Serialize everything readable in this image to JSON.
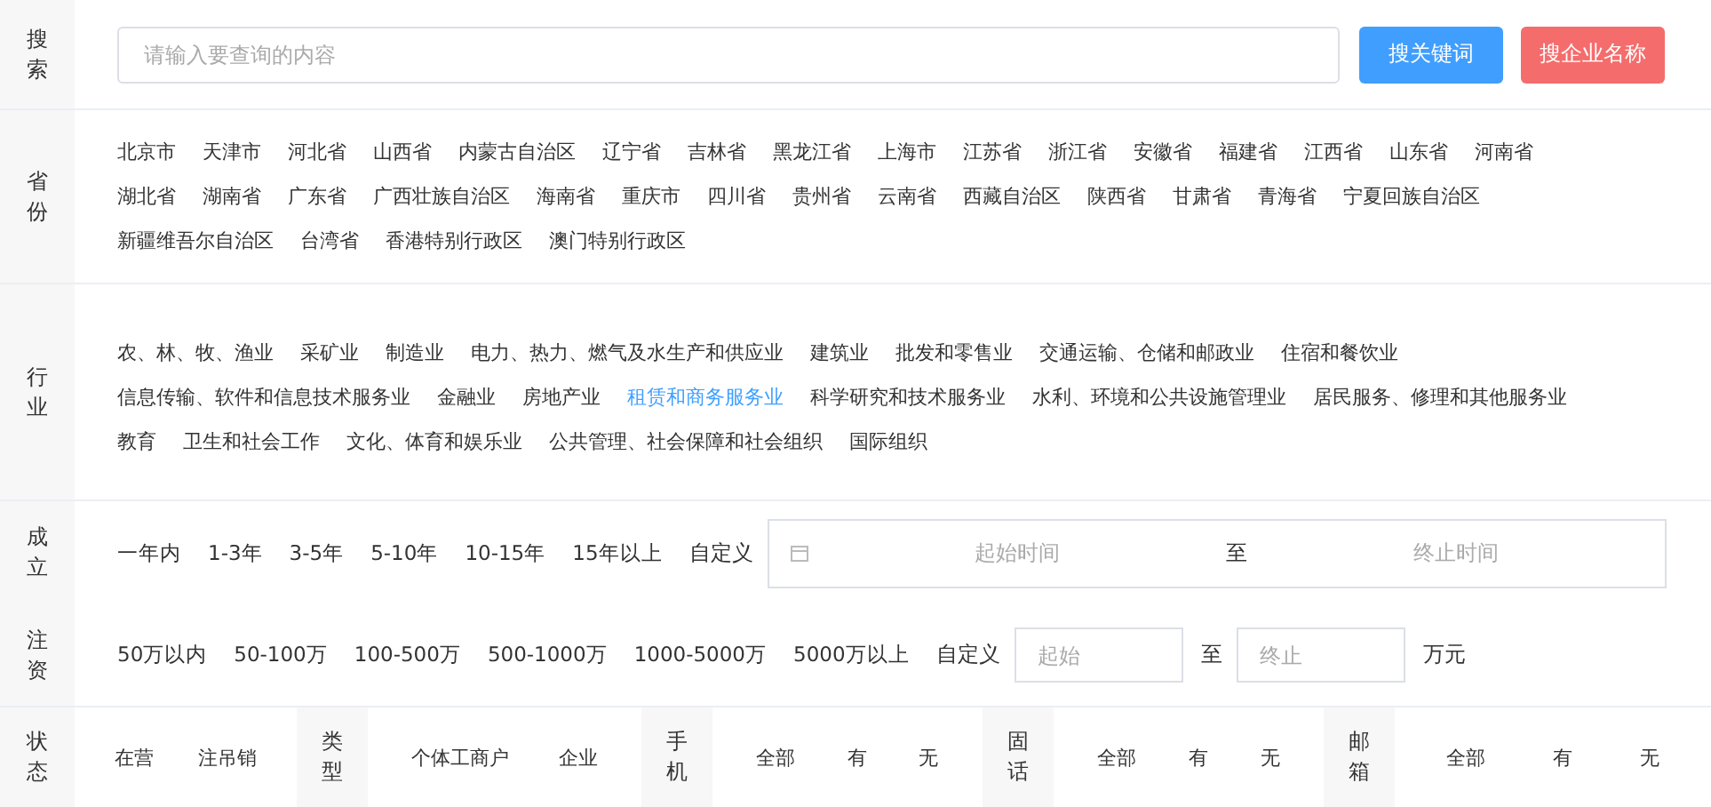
{
  "search": {
    "label": "搜索",
    "placeholder": "请输入要查询的内容",
    "buttons": [
      {
        "label": "搜关键词",
        "kind": "primary"
      },
      {
        "label": "搜企业名称",
        "kind": "danger"
      }
    ]
  },
  "provinces": {
    "label": "省份",
    "options": [
      {
        "label": "北京市",
        "selected": false
      },
      {
        "label": "天津市",
        "selected": false
      },
      {
        "label": "河北省",
        "selected": false
      },
      {
        "label": "山西省",
        "selected": false
      },
      {
        "label": "内蒙古自治区",
        "selected": false
      },
      {
        "label": "辽宁省",
        "selected": false
      },
      {
        "label": "吉林省",
        "selected": false
      },
      {
        "label": "黑龙江省",
        "selected": false
      },
      {
        "label": "上海市",
        "selected": false
      },
      {
        "label": "江苏省",
        "selected": false
      },
      {
        "label": "浙江省",
        "selected": false
      },
      {
        "label": "安徽省",
        "selected": false
      },
      {
        "label": "福建省",
        "selected": false
      },
      {
        "label": "江西省",
        "selected": false
      },
      {
        "label": "山东省",
        "selected": false
      },
      {
        "label": "河南省",
        "selected": false
      },
      {
        "label": "湖北省",
        "selected": false
      },
      {
        "label": "湖南省",
        "selected": false
      },
      {
        "label": "广东省",
        "selected": false
      },
      {
        "label": "广西壮族自治区",
        "selected": false
      },
      {
        "label": "海南省",
        "selected": false
      },
      {
        "label": "重庆市",
        "selected": false
      },
      {
        "label": "四川省",
        "selected": false
      },
      {
        "label": "贵州省",
        "selected": false
      },
      {
        "label": "云南省",
        "selected": false
      },
      {
        "label": "西藏自治区",
        "selected": false
      },
      {
        "label": "陕西省",
        "selected": false
      },
      {
        "label": "甘肃省",
        "selected": false
      },
      {
        "label": "青海省",
        "selected": false
      },
      {
        "label": "宁夏回族自治区",
        "selected": false
      },
      {
        "label": "新疆维吾尔自治区",
        "selected": false
      },
      {
        "label": "台湾省",
        "selected": false
      },
      {
        "label": "香港特别行政区",
        "selected": false
      },
      {
        "label": "澳门特别行政区",
        "selected": false
      }
    ]
  },
  "industries": {
    "label": "行业",
    "options": [
      {
        "label": "农、林、牧、渔业",
        "selected": false
      },
      {
        "label": "采矿业",
        "selected": false
      },
      {
        "label": "制造业",
        "selected": false
      },
      {
        "label": "电力、热力、燃气及水生产和供应业",
        "selected": false
      },
      {
        "label": "建筑业",
        "selected": false
      },
      {
        "label": "批发和零售业",
        "selected": false
      },
      {
        "label": "交通运输、仓储和邮政业",
        "selected": false
      },
      {
        "label": "住宿和餐饮业",
        "selected": false
      },
      {
        "label": "信息传输、软件和信息技术服务业",
        "selected": false
      },
      {
        "label": "金融业",
        "selected": false
      },
      {
        "label": "房地产业",
        "selected": false
      },
      {
        "label": "租赁和商务服务业",
        "selected": true
      },
      {
        "label": "科学研究和技术服务业",
        "selected": false
      },
      {
        "label": "水利、环境和公共设施管理业",
        "selected": false
      },
      {
        "label": "居民服务、修理和其他服务业",
        "selected": false
      },
      {
        "label": "教育",
        "selected": false
      },
      {
        "label": "卫生和社会工作",
        "selected": false
      },
      {
        "label": "文化、体育和娱乐业",
        "selected": false
      },
      {
        "label": "公共管理、社会保障和社会组织",
        "selected": false
      },
      {
        "label": "国际组织",
        "selected": false
      }
    ]
  },
  "established": {
    "label": "成立",
    "options": [
      {
        "label": "一年内",
        "selected": false
      },
      {
        "label": "1-3年",
        "selected": false
      },
      {
        "label": "3-5年",
        "selected": false
      },
      {
        "label": "5-10年",
        "selected": false
      },
      {
        "label": "10-15年",
        "selected": false
      },
      {
        "label": "15年以上",
        "selected": false
      }
    ],
    "custom_label": "自定义",
    "range": {
      "start_placeholder": "起始时间",
      "separator": "至",
      "end_placeholder": "终止时间"
    }
  },
  "capital": {
    "label": "注资",
    "options": [
      {
        "label": "50万以内",
        "selected": false
      },
      {
        "label": "50-100万",
        "selected": false
      },
      {
        "label": "100-500万",
        "selected": false
      },
      {
        "label": "500-1000万",
        "selected": false
      },
      {
        "label": "1000-5000万",
        "selected": false
      },
      {
        "label": "5000万以上",
        "selected": false
      }
    ],
    "custom_label": "自定义",
    "range": {
      "start_placeholder": "起始",
      "separator": "至",
      "end_placeholder": "终止"
    },
    "unit": "万元"
  },
  "status_row": {
    "groups": [
      {
        "label": "状态",
        "options": [
          {
            "label": "在营",
            "selected": false
          },
          {
            "label": "注吊销",
            "selected": false
          }
        ]
      },
      {
        "label": "类型",
        "options": [
          {
            "label": "个体工商户",
            "selected": false
          },
          {
            "label": "企业",
            "selected": false
          }
        ]
      },
      {
        "label": "手机",
        "options": [
          {
            "label": "全部",
            "selected": false
          },
          {
            "label": "有",
            "selected": false
          },
          {
            "label": "无",
            "selected": false
          }
        ]
      },
      {
        "label": "固话",
        "options": [
          {
            "label": "全部",
            "selected": false
          },
          {
            "label": "有",
            "selected": false
          },
          {
            "label": "无",
            "selected": false
          }
        ]
      },
      {
        "label": "邮箱",
        "options": [
          {
            "label": "全部",
            "selected": false
          },
          {
            "label": "有",
            "selected": false
          },
          {
            "label": "无",
            "selected": false
          }
        ]
      }
    ]
  }
}
